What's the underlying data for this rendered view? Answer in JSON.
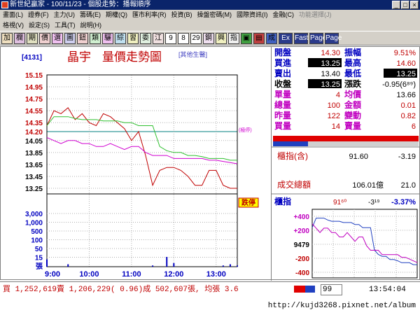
{
  "window": {
    "title": "新世紀贏家 - 100/11/23 - 個股走勢：播報順序"
  },
  "menu": {
    "row1": [
      "畫面(L)",
      "證券(F)",
      "主力(U)",
      "籌碼(E)",
      "期權(Q)",
      "匯市利率(R)",
      "投資(B)",
      "操盤密碼(M)",
      "國際資訊(I)",
      "金融(C)",
      "功能選擇(J)"
    ],
    "row1_disabled": "功能選擇(J)",
    "row2": [
      "格視(V)",
      "設定(S)",
      "工具(T)",
      "說明(H)"
    ]
  },
  "toolbar": [
    "加",
    "欄",
    "期",
    "價",
    "選",
    "圖",
    "鈕",
    "類",
    "驪",
    "綜",
    "習",
    "委",
    "江",
    "9",
    "8",
    "29",
    "鋼",
    "興",
    "指",
    "▣",
    "▤",
    "成",
    "Ex",
    "Fast",
    "Page",
    "Page"
  ],
  "stock": {
    "code": "[4131]",
    "name": "晶宇",
    "chart_title": "量價走勢圖",
    "category": "[其他生醫]"
  },
  "y_price_ticks": [
    "15.15",
    "14.95",
    "14.75",
    "14.55",
    "14.35",
    "14.20",
    "14.05",
    "13.85",
    "13.65",
    "13.45",
    "13.25"
  ],
  "y_vol_ticks": [
    "3,000",
    "1,000",
    "500",
    "100",
    "50",
    "15",
    "張"
  ],
  "x_ticks": [
    "9:00",
    "10:00",
    "11:00",
    "12:00",
    "13:00"
  ],
  "limit_down_label": "跌停",
  "limit_up_mark": "(極停)",
  "chart_data": {
    "type": "line",
    "x": [
      "9:00",
      "9:10",
      "9:20",
      "9:30",
      "9:40",
      "9:50",
      "10:00",
      "10:10",
      "10:20",
      "10:30",
      "10:40",
      "10:50",
      "11:00",
      "11:10",
      "11:20",
      "11:30",
      "11:40",
      "11:50",
      "12:00",
      "12:10",
      "12:20",
      "12:30",
      "12:40",
      "12:50",
      "13:00",
      "13:10",
      "13:20",
      "13:30"
    ],
    "series": [
      {
        "name": "price",
        "color": "#c00000",
        "values": [
          14.3,
          14.55,
          14.5,
          14.6,
          14.4,
          14.5,
          14.35,
          14.3,
          14.5,
          14.45,
          14.35,
          14.25,
          14.05,
          14.2,
          13.8,
          13.3,
          13.55,
          13.6,
          13.6,
          13.55,
          13.45,
          13.3,
          13.3,
          13.55,
          13.55,
          13.3,
          13.25,
          13.25
        ]
      },
      {
        "name": "average",
        "color": "#d000d0",
        "values": [
          14.1,
          14.05,
          14.0,
          14.05,
          14.05,
          14.0,
          14.0,
          13.95,
          13.95,
          14.0,
          13.95,
          13.9,
          13.95,
          13.95,
          13.85,
          13.8,
          13.8,
          13.8,
          13.75,
          13.75,
          13.75,
          13.75,
          13.75,
          13.72,
          13.72,
          13.7,
          13.68,
          13.66
        ]
      },
      {
        "name": "index",
        "color": "#30c030",
        "values": [
          14.3,
          14.45,
          14.45,
          14.45,
          14.42,
          14.4,
          14.4,
          14.4,
          14.38,
          14.38,
          14.38,
          14.35,
          14.35,
          14.3,
          14.3,
          14.3,
          13.95,
          13.88,
          13.85,
          13.85,
          13.8,
          13.8,
          13.78,
          13.75,
          13.75,
          13.75,
          13.72,
          13.72
        ]
      }
    ],
    "volume": [
      6,
      0,
      0,
      2,
      0,
      0,
      0,
      0,
      0,
      0,
      0,
      0,
      0,
      0,
      0,
      1,
      0,
      8,
      3,
      0,
      0,
      0,
      0,
      0,
      0,
      1,
      2,
      1
    ],
    "ylim": [
      13.25,
      15.15
    ],
    "reference_price": 14.2
  },
  "quote": {
    "open_lbl": "開盤",
    "open": "14.30",
    "amp_lbl": "振幅",
    "amp": "9.51%",
    "bid_lbl": "買進",
    "bid": "13.25",
    "high_lbl": "最高",
    "high": "14.60",
    "ask_lbl": "賣出",
    "ask": "13.40",
    "low_lbl": "最低",
    "low": "13.25",
    "close_lbl": "收盤",
    "close": "13.25",
    "chg_lbl": "漲跌",
    "chg": "-0.95(6⁸⁹)",
    "vol_lbl": "單量",
    "vol": "4",
    "avg_lbl": "均價",
    "avg": "13.66",
    "tvol_lbl": "總量",
    "tvol": "100",
    "amt_lbl": "金額",
    "amt": "0.01",
    "pvol_lbl": "昨量",
    "pvol": "122",
    "var_lbl": "變動",
    "var": "0.82",
    "bvol_lbl": "買量",
    "bvol": "14",
    "svol_lbl": "賣量",
    "svol": "6"
  },
  "otc": {
    "label": "櫃指(含)",
    "value": "91.60",
    "chg": "-3.19",
    "turnover_label": "成交總額",
    "turnover": "106.01億",
    "turnover_chg": "21.0"
  },
  "mini": {
    "label": "櫃指",
    "value": "91⁶⁰",
    "chg": "-3¹⁹",
    "pct": "-3.37%",
    "ticks": [
      "+400",
      "+200",
      "9479",
      "-200",
      "-400"
    ]
  },
  "status": {
    "text": "買 1,252,619賣 1,206,229( 0.96)成 502,607張, 均張 3.6",
    "box": "99",
    "time": "13:54:04"
  },
  "url": "http://kujd3268.pixnet.net/album"
}
